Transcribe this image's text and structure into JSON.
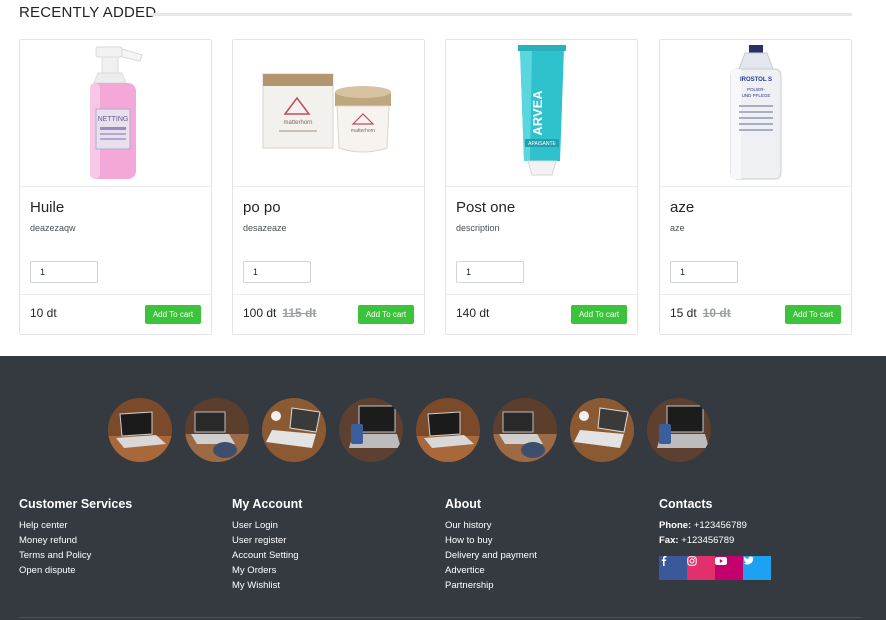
{
  "section": {
    "title": "RECENTLY ADDED"
  },
  "products": [
    {
      "name": "Huile",
      "description": "deazezaqw",
      "quantity": "1",
      "price": "10 dt",
      "old_price": "",
      "button": "Add To cart"
    },
    {
      "name": "po po",
      "description": "desazeaze",
      "quantity": "1",
      "price": "100 dt",
      "old_price": "115 dt",
      "button": "Add To cart"
    },
    {
      "name": "Post one",
      "description": "description",
      "quantity": "1",
      "price": "140 dt",
      "old_price": "",
      "button": "Add To cart"
    },
    {
      "name": "aze",
      "description": "aze",
      "quantity": "1",
      "price": "15 dt",
      "old_price": "10 dt",
      "button": "Add To cart"
    }
  ],
  "footer": {
    "customer_services": {
      "title": "Customer Services",
      "links": [
        "Help center",
        "Money refund",
        "Terms and Policy",
        "Open dispute"
      ]
    },
    "my_account": {
      "title": "My Account",
      "links": [
        "User Login",
        "User register",
        "Account Setting",
        "My Orders",
        "My Wishlist"
      ]
    },
    "about": {
      "title": "About",
      "links": [
        "Our history",
        "How to buy",
        "Delivery and payment",
        "Advertice",
        "Partnership"
      ]
    },
    "contacts": {
      "title": "Contacts",
      "phone_label": "Phone:",
      "phone": "+123456789",
      "fax_label": "Fax:",
      "fax": "+123456789"
    },
    "socials": [
      {
        "name": "facebook-icon",
        "glyph": "f",
        "color": "#3b5998"
      },
      {
        "name": "instagram-icon",
        "glyph": "◎",
        "color": "#e1306c"
      },
      {
        "name": "youtube-icon",
        "glyph": "▶",
        "color": "#c4006e"
      },
      {
        "name": "twitter-icon",
        "glyph": "t",
        "color": "#1da1f2"
      }
    ]
  },
  "colors": {
    "accent_green": "#3cc33c",
    "footer_bg": "#343a40"
  }
}
